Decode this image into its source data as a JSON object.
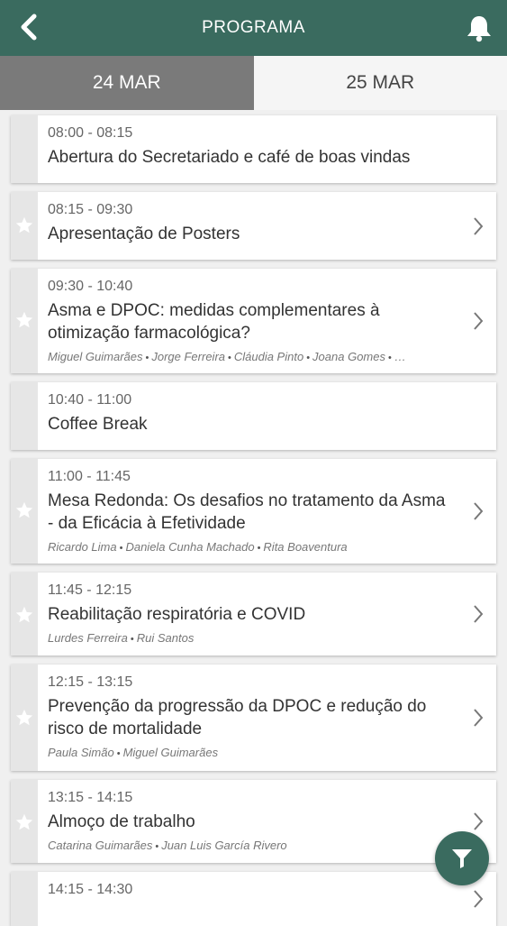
{
  "header": {
    "title": "PROGRAMA"
  },
  "tabs": [
    {
      "label": "24 MAR",
      "active": true
    },
    {
      "label": "25 MAR",
      "active": false
    }
  ],
  "sessions": [
    {
      "time": "08:00 - 08:15",
      "title": "Abertura do Secretariado e café de boas vindas",
      "speakers": [],
      "star": false,
      "chevron": false
    },
    {
      "time": "08:15 - 09:30",
      "title": "Apresentação de Posters",
      "speakers": [],
      "star": true,
      "chevron": true
    },
    {
      "time": "09:30 - 10:40",
      "title": "Asma e DPOC: medidas complementares à otimização farmacológica?",
      "speakers": [
        "Miguel Guimarães",
        "Jorge Ferreira",
        "Cláudia Pinto",
        "Joana Gomes",
        "…"
      ],
      "star": true,
      "chevron": true
    },
    {
      "time": "10:40 - 11:00",
      "title": "Coffee Break",
      "speakers": [],
      "star": false,
      "chevron": false
    },
    {
      "time": "11:00 - 11:45",
      "title": "Mesa Redonda: Os desafios no tratamento da Asma - da Eficácia à Efetividade",
      "speakers": [
        "Ricardo Lima",
        "Daniela Cunha Machado",
        "Rita Boaventura"
      ],
      "star": true,
      "chevron": true
    },
    {
      "time": "11:45 - 12:15",
      "title": "Reabilitação respiratória e COVID",
      "speakers": [
        "Lurdes Ferreira",
        "Rui Santos"
      ],
      "star": true,
      "chevron": true
    },
    {
      "time": "12:15 - 13:15",
      "title": "Prevenção da progressão da DPOC e redução do risco de mortalidade",
      "speakers": [
        "Paula Simão",
        "Miguel Guimarães"
      ],
      "star": true,
      "chevron": true
    },
    {
      "time": "13:15 - 14:15",
      "title": "Almoço de trabalho",
      "speakers": [
        "Catarina Guimarães",
        "Juan Luis García Rivero"
      ],
      "star": true,
      "chevron": true
    },
    {
      "time": "14:15 - 14:30",
      "title": "",
      "speakers": [],
      "star": false,
      "chevron": true
    }
  ],
  "colors": {
    "primary": "#3a6b5f",
    "tab_active": "#7a7a7a"
  },
  "icons": {
    "back": "chevron-left-icon",
    "notifications": "bell-icon",
    "favorite": "star-icon",
    "open": "chevron-right-icon",
    "filter": "filter-icon"
  }
}
